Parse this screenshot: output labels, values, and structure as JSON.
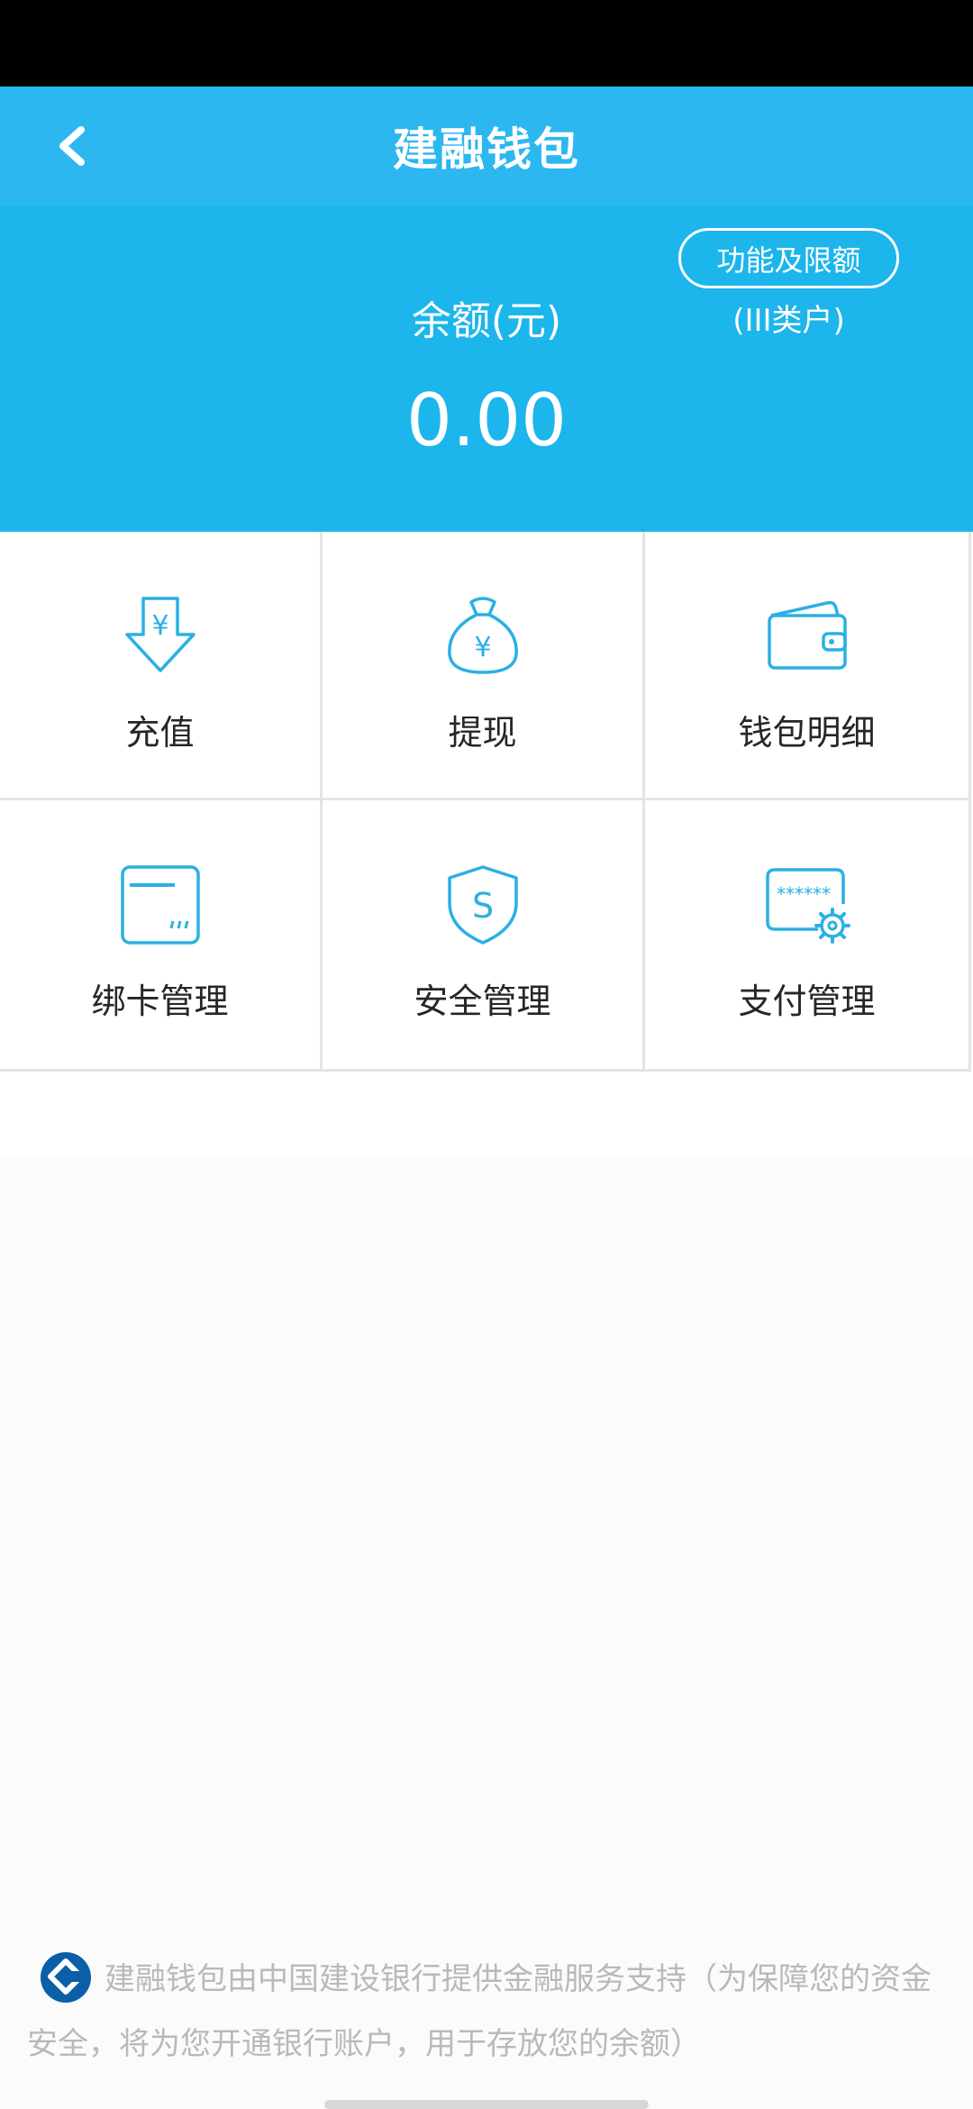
{
  "header": {
    "title": "建融钱包"
  },
  "balance": {
    "label": "余额(元)",
    "amount": "0.00",
    "limits_button": "功能及限额",
    "account_type": "(III类户)"
  },
  "menu": [
    {
      "label": "充值",
      "icon": "recharge-icon"
    },
    {
      "label": "提现",
      "icon": "withdraw-money-bag-icon"
    },
    {
      "label": "钱包明细",
      "icon": "wallet-icon"
    },
    {
      "label": "绑卡管理",
      "icon": "bank-card-icon"
    },
    {
      "label": "安全管理",
      "icon": "security-shield-icon"
    },
    {
      "label": "支付管理",
      "icon": "password-settings-icon"
    }
  ],
  "footer": {
    "text": "建融钱包由中国建设银行提供金融服务支持（为保障您的资金安全，将为您开通银行账户，用于存放您的余额）"
  },
  "colors": {
    "header_bg": "#2cb7f1",
    "panel_bg": "#1cb5ec",
    "icon_blue": "#2bb0e3",
    "logo_blue": "#0a5fa8"
  }
}
